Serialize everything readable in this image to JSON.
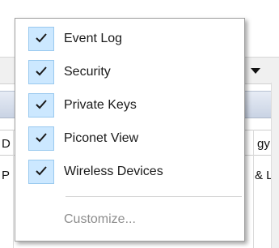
{
  "background_window": {
    "column_header_left": "D",
    "column_header_right": "gy",
    "row_text_left": "P",
    "row_text_right": "& L"
  },
  "context_menu": {
    "items": [
      {
        "label": "Event Log",
        "checked": true
      },
      {
        "label": "Security",
        "checked": true
      },
      {
        "label": "Private Keys",
        "checked": true
      },
      {
        "label": "Piconet View",
        "checked": true
      },
      {
        "label": "Wireless Devices",
        "checked": true
      }
    ],
    "customize_label": "Customize...",
    "customize_enabled": false
  },
  "colors": {
    "check_bg": "#cce8ff",
    "check_border": "#99c9ef",
    "disabled_text": "#8d8d8d"
  }
}
